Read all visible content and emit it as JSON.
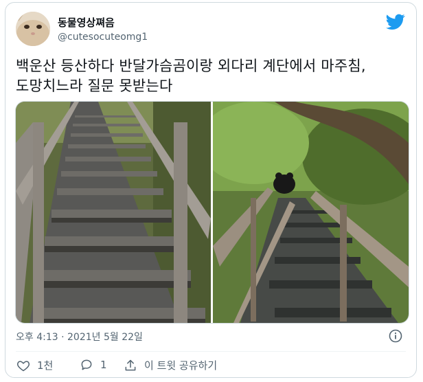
{
  "author": {
    "name": "동물영상쪄음",
    "handle": "@cutesocuteomg1"
  },
  "tweet": {
    "text": "백운산 등산하다 반달가슴곰이랑 외다리 계단에서 마주침,\n도망치느라 질문 못받는다",
    "timestamp": "오후 4:13 · 2021년 5월 22일"
  },
  "actions": {
    "like_count": "1천",
    "reply_count": "1",
    "share_label": "이 트윗 공유하기"
  },
  "icons": {
    "brand": "twitter-bird-icon",
    "info": "info-icon",
    "like": "heart-icon",
    "reply": "reply-bubble-icon",
    "share": "share-upload-icon"
  },
  "colors": {
    "brand": "#1d9bf0",
    "secondary_text": "#536471",
    "border": "#cfd9de"
  }
}
